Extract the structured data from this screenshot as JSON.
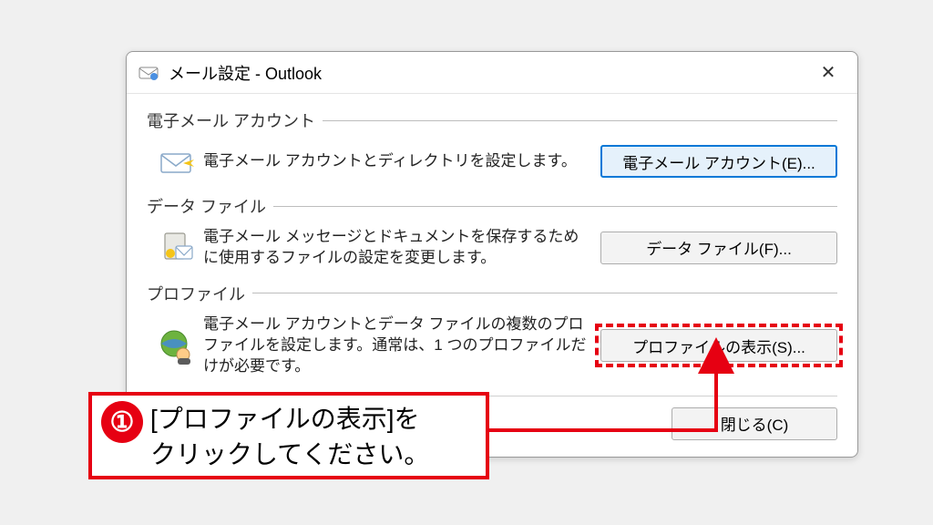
{
  "dialog": {
    "title": "メール設定 - Outlook"
  },
  "sections": {
    "email": {
      "legend": "電子メール アカウント",
      "desc": "電子メール アカウントとディレクトリを設定します。",
      "button": "電子メール アカウント(E)..."
    },
    "data": {
      "legend": "データ ファイル",
      "desc": "電子メール メッセージとドキュメントを保存するために使用するファイルの設定を変更します。",
      "button": "データ ファイル(F)..."
    },
    "profile": {
      "legend": "プロファイル",
      "desc": "電子メール アカウントとデータ ファイルの複数のプロファイルを設定します。通常は、1 つのプロファイルだけが必要です。",
      "button": "プロファイルの表示(S)..."
    }
  },
  "close_button": "閉じる(C)",
  "callout": {
    "badge": "①",
    "text": "[プロファイルの表示]を\nクリックしてください。"
  }
}
